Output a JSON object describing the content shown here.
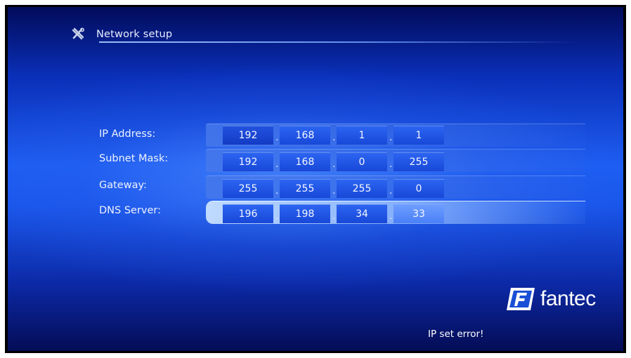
{
  "header": {
    "icon": "tools-icon",
    "title": "Network setup"
  },
  "fields": [
    {
      "label": "IP Address:",
      "octets": [
        "192",
        "168",
        "1",
        "1"
      ],
      "selected": false
    },
    {
      "label": "Subnet Mask:",
      "octets": [
        "192",
        "168",
        "0",
        "255"
      ],
      "selected": false
    },
    {
      "label": "Gateway:",
      "octets": [
        "255",
        "255",
        "255",
        "0"
      ],
      "selected": false
    },
    {
      "label": "DNS Server:",
      "octets": [
        "196",
        "198",
        "34",
        "33"
      ],
      "selected": true
    }
  ],
  "separator": ".",
  "brand": {
    "name": "fantec",
    "mark": "F"
  },
  "status": {
    "message": "IP set error!"
  },
  "colors": {
    "background": "#1a56ea",
    "octet_box": "#2c64f2",
    "text": "#ffffff"
  }
}
